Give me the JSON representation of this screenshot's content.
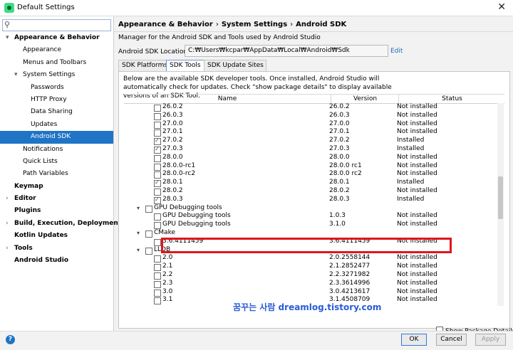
{
  "window": {
    "title": "Default Settings"
  },
  "search": {
    "placeholder": ""
  },
  "sidebar": {
    "items": [
      {
        "label": "Appearance & Behavior",
        "indent": 0,
        "expanded": true,
        "bold": true
      },
      {
        "label": "Appearance",
        "indent": 1
      },
      {
        "label": "Menus and Toolbars",
        "indent": 1
      },
      {
        "label": "System Settings",
        "indent": 1,
        "expanded": true
      },
      {
        "label": "Passwords",
        "indent": 2
      },
      {
        "label": "HTTP Proxy",
        "indent": 2
      },
      {
        "label": "Data Sharing",
        "indent": 2
      },
      {
        "label": "Updates",
        "indent": 2
      },
      {
        "label": "Android SDK",
        "indent": 2,
        "selected": true
      },
      {
        "label": "Notifications",
        "indent": 1
      },
      {
        "label": "Quick Lists",
        "indent": 1
      },
      {
        "label": "Path Variables",
        "indent": 1
      },
      {
        "label": "Keymap",
        "indent": 0,
        "bold": true
      },
      {
        "label": "Editor",
        "indent": 0,
        "expanded": false,
        "bold": true
      },
      {
        "label": "Plugins",
        "indent": 0,
        "bold": true
      },
      {
        "label": "Build, Execution, Deployment",
        "indent": 0,
        "expanded": false,
        "bold": true
      },
      {
        "label": "Kotlin Updates",
        "indent": 0,
        "bold": true
      },
      {
        "label": "Tools",
        "indent": 0,
        "expanded": false,
        "bold": true
      },
      {
        "label": "Android Studio",
        "indent": 0,
        "bold": true
      }
    ]
  },
  "breadcrumb": {
    "part1": "Appearance & Behavior",
    "part2": "System Settings",
    "part3": "Android SDK",
    "separator": "›"
  },
  "manager_desc": "Manager for the Android SDK and Tools used by Android Studio",
  "sdk_location": {
    "label": "Android SDK Location:",
    "value": "C:₩Users₩kcpar₩AppData₩Local₩Android₩Sdk",
    "edit_label": "Edit"
  },
  "tabs": [
    {
      "label": "SDK Platforms",
      "active": false
    },
    {
      "label": "SDK Tools",
      "active": true
    },
    {
      "label": "SDK Update Sites",
      "active": false
    }
  ],
  "panel": {
    "description": "Below are the available SDK developer tools. Once installed, Android Studio will automatically check for updates. Check \"show package details\" to display available versions of an SDK Tool.",
    "columns": {
      "name": "Name",
      "version": "Version",
      "status": "Status"
    },
    "rows": [
      {
        "level": 2,
        "name": "26.0.2",
        "version": "26.0.2",
        "status": "Not installed",
        "checked": false
      },
      {
        "level": 2,
        "name": "26.0.3",
        "version": "26.0.3",
        "status": "Not installed",
        "checked": false
      },
      {
        "level": 2,
        "name": "27.0.0",
        "version": "27.0.0",
        "status": "Not installed",
        "checked": false
      },
      {
        "level": 2,
        "name": "27.0.1",
        "version": "27.0.1",
        "status": "Not installed",
        "checked": false
      },
      {
        "level": 2,
        "name": "27.0.2",
        "version": "27.0.2",
        "status": "Installed",
        "checked": true
      },
      {
        "level": 2,
        "name": "27.0.3",
        "version": "27.0.3",
        "status": "Installed",
        "checked": true
      },
      {
        "level": 2,
        "name": "28.0.0",
        "version": "28.0.0",
        "status": "Not installed",
        "checked": false
      },
      {
        "level": 2,
        "name": "28.0.0-rc1",
        "version": "28.0.0 rc1",
        "status": "Not installed",
        "checked": false
      },
      {
        "level": 2,
        "name": "28.0.0-rc2",
        "version": "28.0.0 rc2",
        "status": "Not installed",
        "checked": false
      },
      {
        "level": 2,
        "name": "28.0.1",
        "version": "28.0.1",
        "status": "Installed",
        "checked": true
      },
      {
        "level": 2,
        "name": "28.0.2",
        "version": "28.0.2",
        "status": "Not installed",
        "checked": false
      },
      {
        "level": 2,
        "name": "28.0.3",
        "version": "28.0.3",
        "status": "Installed",
        "checked": true
      },
      {
        "level": 1,
        "name": "GPU Debugging tools",
        "version": "",
        "status": "",
        "checked": false,
        "group": true
      },
      {
        "level": 2,
        "name": "GPU Debugging tools",
        "version": "1.0.3",
        "status": "Not installed",
        "checked": false
      },
      {
        "level": 2,
        "name": "GPU Debugging tools",
        "version": "3.1.0",
        "status": "Not installed",
        "checked": false
      },
      {
        "level": 1,
        "name": "CMake",
        "version": "",
        "status": "",
        "checked": false,
        "group": true
      },
      {
        "level": 2,
        "name": "3.6.4111459",
        "version": "3.6.4111459",
        "status": "Not installed",
        "checked": false
      },
      {
        "level": 1,
        "name": "LLDB",
        "version": "",
        "status": "",
        "checked": false,
        "group": true
      },
      {
        "level": 2,
        "name": "2.0",
        "version": "2.0.2558144",
        "status": "Not installed",
        "checked": false
      },
      {
        "level": 2,
        "name": "2.1",
        "version": "2.1.2852477",
        "status": "Not installed",
        "checked": false
      },
      {
        "level": 2,
        "name": "2.2",
        "version": "2.2.3271982",
        "status": "Not installed",
        "checked": false
      },
      {
        "level": 2,
        "name": "2.3",
        "version": "2.3.3614996",
        "status": "Not installed",
        "checked": false
      },
      {
        "level": 2,
        "name": "3.0",
        "version": "3.0.4213617",
        "status": "Not installed",
        "checked": false
      },
      {
        "level": 2,
        "name": "3.1",
        "version": "3.1.4508709",
        "status": "Not installed",
        "checked": false
      }
    ],
    "show_package_details": "Show Package Details"
  },
  "watermark": "꿈꾸는 사람 dreamlog.tistory.com",
  "buttons": {
    "ok": "OK",
    "cancel": "Cancel",
    "apply": "Apply",
    "help": "?"
  },
  "colors": {
    "selection": "#1f74c6",
    "highlight_box": "#e0161c",
    "link": "#2767b9"
  }
}
